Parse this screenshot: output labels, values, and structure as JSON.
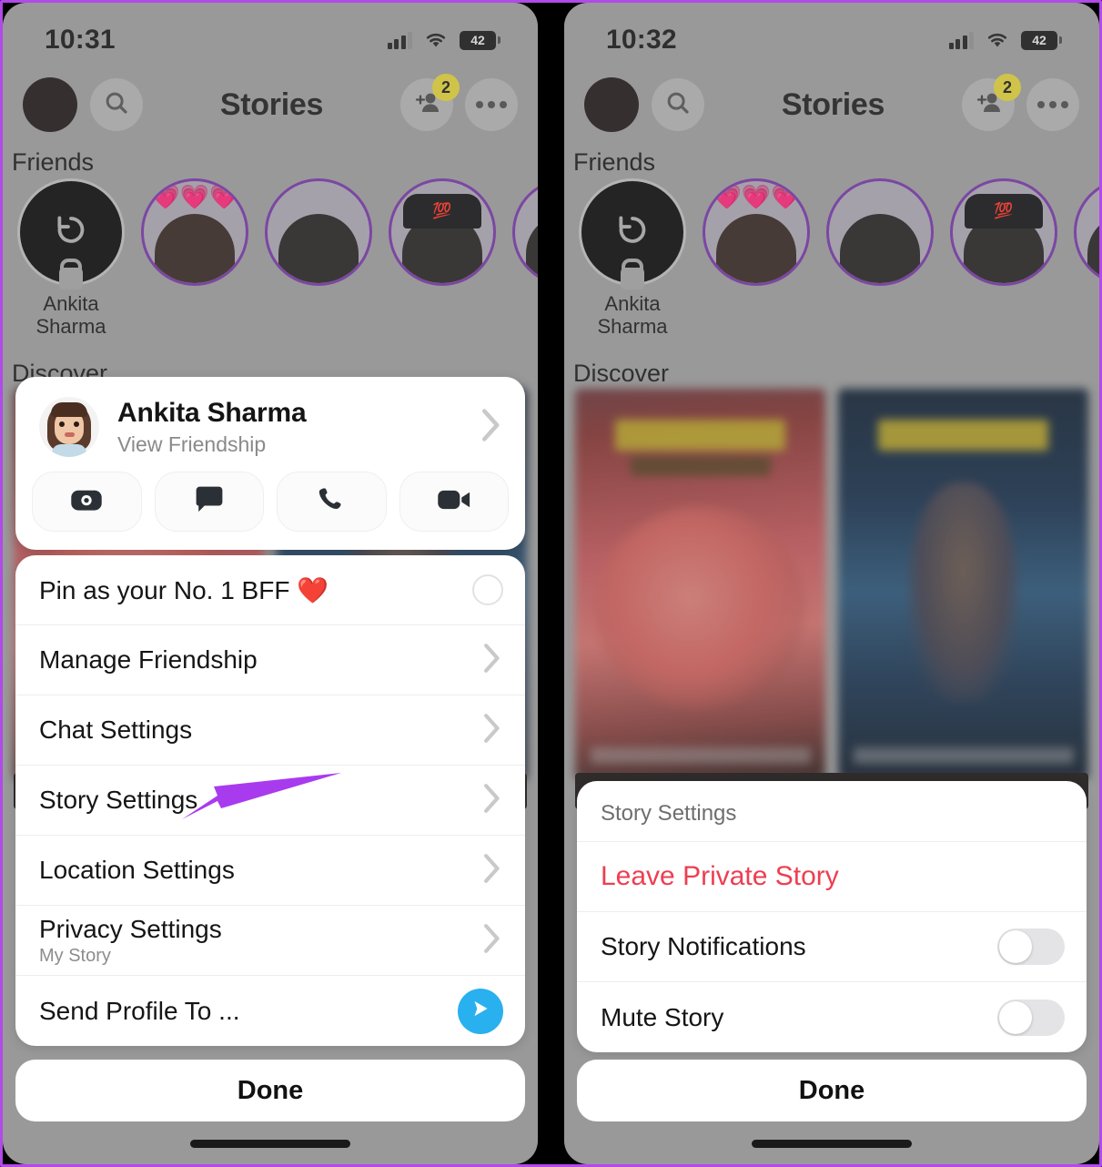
{
  "meta": {
    "annotation_arrow_color": "#a93bef",
    "border_color": "#b14ae8",
    "accent_blue": "#29b0ee",
    "danger_red": "#ee3e51",
    "badge_yellow": "#f5e636",
    "story_ring_purple": "#7d33b5"
  },
  "panels": [
    {
      "id": "left",
      "statusbar": {
        "time": "10:31",
        "battery": "42",
        "signal_icon": "cellular-signal-icon",
        "wifi_icon": "wifi-icon",
        "battery_icon": "battery-icon"
      },
      "navbar": {
        "avatar_icon": "profile-avatar-icon",
        "search_icon": "search-icon",
        "title": "Stories",
        "add_friend_icon": "add-friend-icon",
        "add_friend_badge": "2",
        "more_icon": "more-options-icon"
      },
      "sections": {
        "friends": "Friends",
        "discover": "Discover"
      },
      "stories": [
        {
          "name": "Ankita Sharma",
          "type": "self",
          "icon": "refresh-icon",
          "lock": true
        },
        {
          "name": "",
          "type": "friend",
          "decoration": "hearts"
        },
        {
          "name": "",
          "type": "friend",
          "decoration": "none"
        },
        {
          "name": "",
          "type": "friend",
          "decoration": "cap-100"
        },
        {
          "name": "",
          "type": "friend",
          "decoration": "none"
        }
      ],
      "profile_card": {
        "name": "Ankita Sharma",
        "subtitle": "View Friendship",
        "chevron_icon": "chevron-right-icon",
        "actions": [
          {
            "name": "camera-action",
            "icon": "camera-icon"
          },
          {
            "name": "chat-action",
            "icon": "chat-bubble-icon"
          },
          {
            "name": "call-action",
            "icon": "phone-icon"
          },
          {
            "name": "video-action",
            "icon": "video-camera-icon"
          }
        ]
      },
      "options": [
        {
          "label": "Pin as your No. 1 BFF ❤️",
          "sub": "",
          "control": "radio",
          "checked": false
        },
        {
          "label": "Manage Friendship",
          "sub": "",
          "control": "chevron"
        },
        {
          "label": "Chat Settings",
          "sub": "",
          "control": "chevron"
        },
        {
          "label": "Story Settings",
          "sub": "",
          "control": "chevron"
        },
        {
          "label": "Location Settings",
          "sub": "",
          "control": "chevron"
        },
        {
          "label": "Privacy Settings",
          "sub": "My Story",
          "control": "chevron"
        },
        {
          "label": "Send Profile To ...",
          "sub": "",
          "control": "send"
        }
      ],
      "done_label": "Done"
    },
    {
      "id": "right",
      "statusbar": {
        "time": "10:32",
        "battery": "42",
        "signal_icon": "cellular-signal-icon",
        "wifi_icon": "wifi-icon",
        "battery_icon": "battery-icon"
      },
      "navbar": {
        "avatar_icon": "profile-avatar-icon",
        "search_icon": "search-icon",
        "title": "Stories",
        "add_friend_icon": "add-friend-icon",
        "add_friend_badge": "2",
        "more_icon": "more-options-icon"
      },
      "sections": {
        "friends": "Friends",
        "discover": "Discover"
      },
      "stories": [
        {
          "name": "Ankita Sharma",
          "type": "self",
          "icon": "refresh-icon",
          "lock": true
        },
        {
          "name": "",
          "type": "friend",
          "decoration": "hearts"
        },
        {
          "name": "",
          "type": "friend",
          "decoration": "none"
        },
        {
          "name": "",
          "type": "friend",
          "decoration": "cap-100"
        },
        {
          "name": "",
          "type": "friend",
          "decoration": "none"
        }
      ],
      "story_settings": {
        "header": "Story Settings",
        "rows": [
          {
            "label": "Leave Private Story",
            "control": "none",
            "style": "danger"
          },
          {
            "label": "Story Notifications",
            "control": "toggle",
            "on": false
          },
          {
            "label": "Mute Story",
            "control": "toggle",
            "on": false
          }
        ]
      },
      "done_label": "Done"
    }
  ],
  "annotations": [
    {
      "name": "arrow-to-story-settings",
      "points_to": "Story Settings"
    },
    {
      "name": "arrow-to-leave-private-story",
      "points_to": "Leave Private Story"
    }
  ]
}
